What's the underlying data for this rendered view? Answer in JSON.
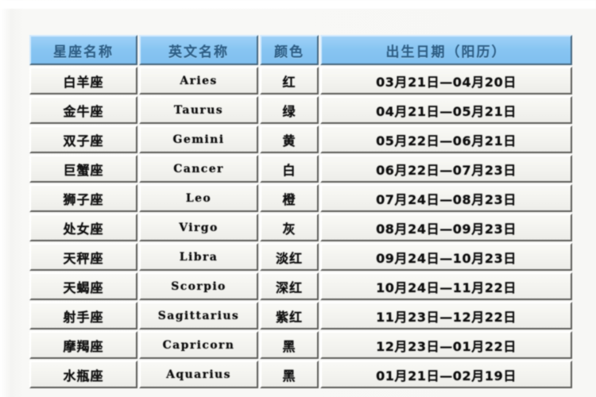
{
  "page": {
    "background_color": "#f7f7f5",
    "top_cropped_text": "··· ·· ····"
  },
  "table": {
    "name": "zodiac-sign-reference-table",
    "header_background_color": "#87c3ef",
    "header_text_color": "#2f5f86",
    "cell_background_color": "#efefeb",
    "cell_text_color": "#121212",
    "columns": [
      {
        "key": "name",
        "label": "星座名称"
      },
      {
        "key": "en",
        "label": "英文名称"
      },
      {
        "key": "color",
        "label": "颜色"
      },
      {
        "key": "date",
        "label": "出生日期（阳历）"
      }
    ],
    "rows": [
      {
        "name": "白羊座",
        "en": "Aries",
        "color": "红",
        "date": "03月21日—04月20日"
      },
      {
        "name": "金牛座",
        "en": "Taurus",
        "color": "绿",
        "date": "04月21日—05月21日"
      },
      {
        "name": "双子座",
        "en": "Gemini",
        "color": "黄",
        "date": "05月22日—06月21日"
      },
      {
        "name": "巨蟹座",
        "en": "Cancer",
        "color": "白",
        "date": "06月22日—07月23日"
      },
      {
        "name": "狮子座",
        "en": "Leo",
        "color": "橙",
        "date": "07月24日—08月23日"
      },
      {
        "name": "处女座",
        "en": "Virgo",
        "color": "灰",
        "date": "08月24日—09月23日"
      },
      {
        "name": "天秤座",
        "en": "Libra",
        "color": "淡红",
        "date": "09月24日—10月23日"
      },
      {
        "name": "天蝎座",
        "en": "Scorpio",
        "color": "深红",
        "date": "10月24日—11月22日"
      },
      {
        "name": "射手座",
        "en": "Sagittarius",
        "color": "紫红",
        "date": "11月23日—12月22日"
      },
      {
        "name": "摩羯座",
        "en": "Capricorn",
        "color": "黑",
        "date": "12月23日—01月22日"
      },
      {
        "name": "水瓶座",
        "en": "Aquarius",
        "color": "黑",
        "date": "01月21日—02月19日"
      }
    ]
  }
}
